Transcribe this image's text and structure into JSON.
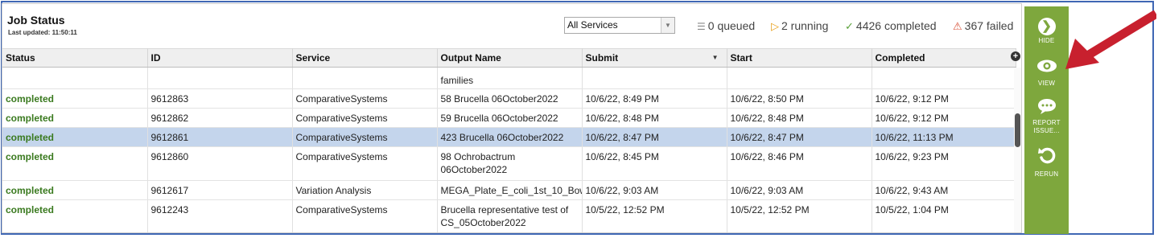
{
  "header": {
    "title": "Job Status",
    "last_updated": "Last updated: 11:50:11"
  },
  "filter": {
    "selected": "All Services"
  },
  "stats": {
    "queued": "0 queued",
    "running": "2 running",
    "completed": "4426 completed",
    "failed": "367 failed"
  },
  "table": {
    "columns": [
      "Status",
      "ID",
      "Service",
      "Output Name",
      "Submit",
      "Start",
      "Completed"
    ],
    "partial_top_output": "families",
    "rows": [
      {
        "status": "completed",
        "id": "9612863",
        "service": "ComparativeSystems",
        "output": "58 Brucella 06October2022",
        "submit": "10/6/22, 8:49 PM",
        "start": "10/6/22, 8:50 PM",
        "completed": "10/6/22, 9:12 PM",
        "selected": false
      },
      {
        "status": "completed",
        "id": "9612862",
        "service": "ComparativeSystems",
        "output": "59 Brucella 06October2022",
        "submit": "10/6/22, 8:48 PM",
        "start": "10/6/22, 8:48 PM",
        "completed": "10/6/22, 9:12 PM",
        "selected": false
      },
      {
        "status": "completed",
        "id": "9612861",
        "service": "ComparativeSystems",
        "output": "423 Brucella 06October2022",
        "submit": "10/6/22, 8:47 PM",
        "start": "10/6/22, 8:47 PM",
        "completed": "10/6/22, 11:13 PM",
        "selected": true
      },
      {
        "status": "completed",
        "id": "9612860",
        "service": "ComparativeSystems",
        "output": "98 Ochrobactrum 06October2022",
        "submit": "10/6/22, 8:45 PM",
        "start": "10/6/22, 8:46 PM",
        "completed": "10/6/22, 9:23 PM",
        "selected": false
      },
      {
        "status": "completed",
        "id": "9612617",
        "service": "Variation Analysis",
        "output": "MEGA_Plate_E_coli_1st_10_Bow",
        "submit": "10/6/22, 9:03 AM",
        "start": "10/6/22, 9:03 AM",
        "completed": "10/6/22, 9:43 AM",
        "selected": false
      },
      {
        "status": "completed",
        "id": "9612243",
        "service": "ComparativeSystems",
        "output": "Brucella representative test of CS_05October2022",
        "submit": "10/5/22, 12:52 PM",
        "start": "10/5/22, 12:52 PM",
        "completed": "10/5/22, 1:04 PM",
        "selected": false
      }
    ]
  },
  "sidebar": {
    "hide": "HIDE",
    "view": "VIEW",
    "report_line1": "REPORT",
    "report_line2": "ISSUE...",
    "rerun": "RERUN"
  },
  "colors": {
    "accent_green": "#7ea73d",
    "status_completed": "#3a7a1f",
    "selected_row": "#c4d5ec",
    "frame_blue": "#3f67b4",
    "arrow_red": "#c8202e"
  }
}
